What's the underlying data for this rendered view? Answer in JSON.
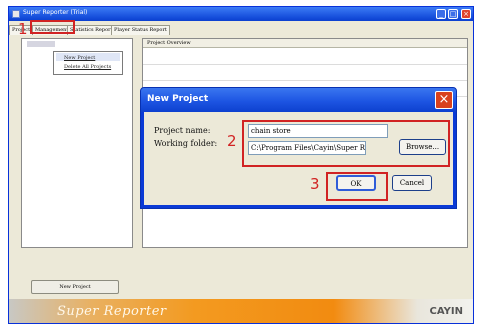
{
  "window": {
    "title": "Super Reporter (Trial)"
  },
  "tabs": [
    "Project",
    "Management",
    "Statistics Report",
    "Player Status Report"
  ],
  "context_menu": {
    "items": [
      "New Project",
      "Delete All Projects"
    ]
  },
  "right_pane": {
    "header": "Project Overview"
  },
  "bottom": {
    "new_project_label": "New Project"
  },
  "banner": {
    "text": "Super Reporter",
    "logo": "CAYIN"
  },
  "dialog": {
    "title": "New Project",
    "project_name_label": "Project name:",
    "project_name_value": "chain store",
    "working_folder_label": "Working folder:",
    "working_folder_value": "C:\\Program Files\\Cayin\\Super Repc",
    "browse_label": "Browse...",
    "ok_label": "OK",
    "cancel_label": "Cancel"
  },
  "callouts": [
    "1",
    "2",
    "3"
  ],
  "colors": {
    "callout": "#d12323",
    "title_bar": "#1d55e2",
    "banner_orange": "#f39a20"
  }
}
